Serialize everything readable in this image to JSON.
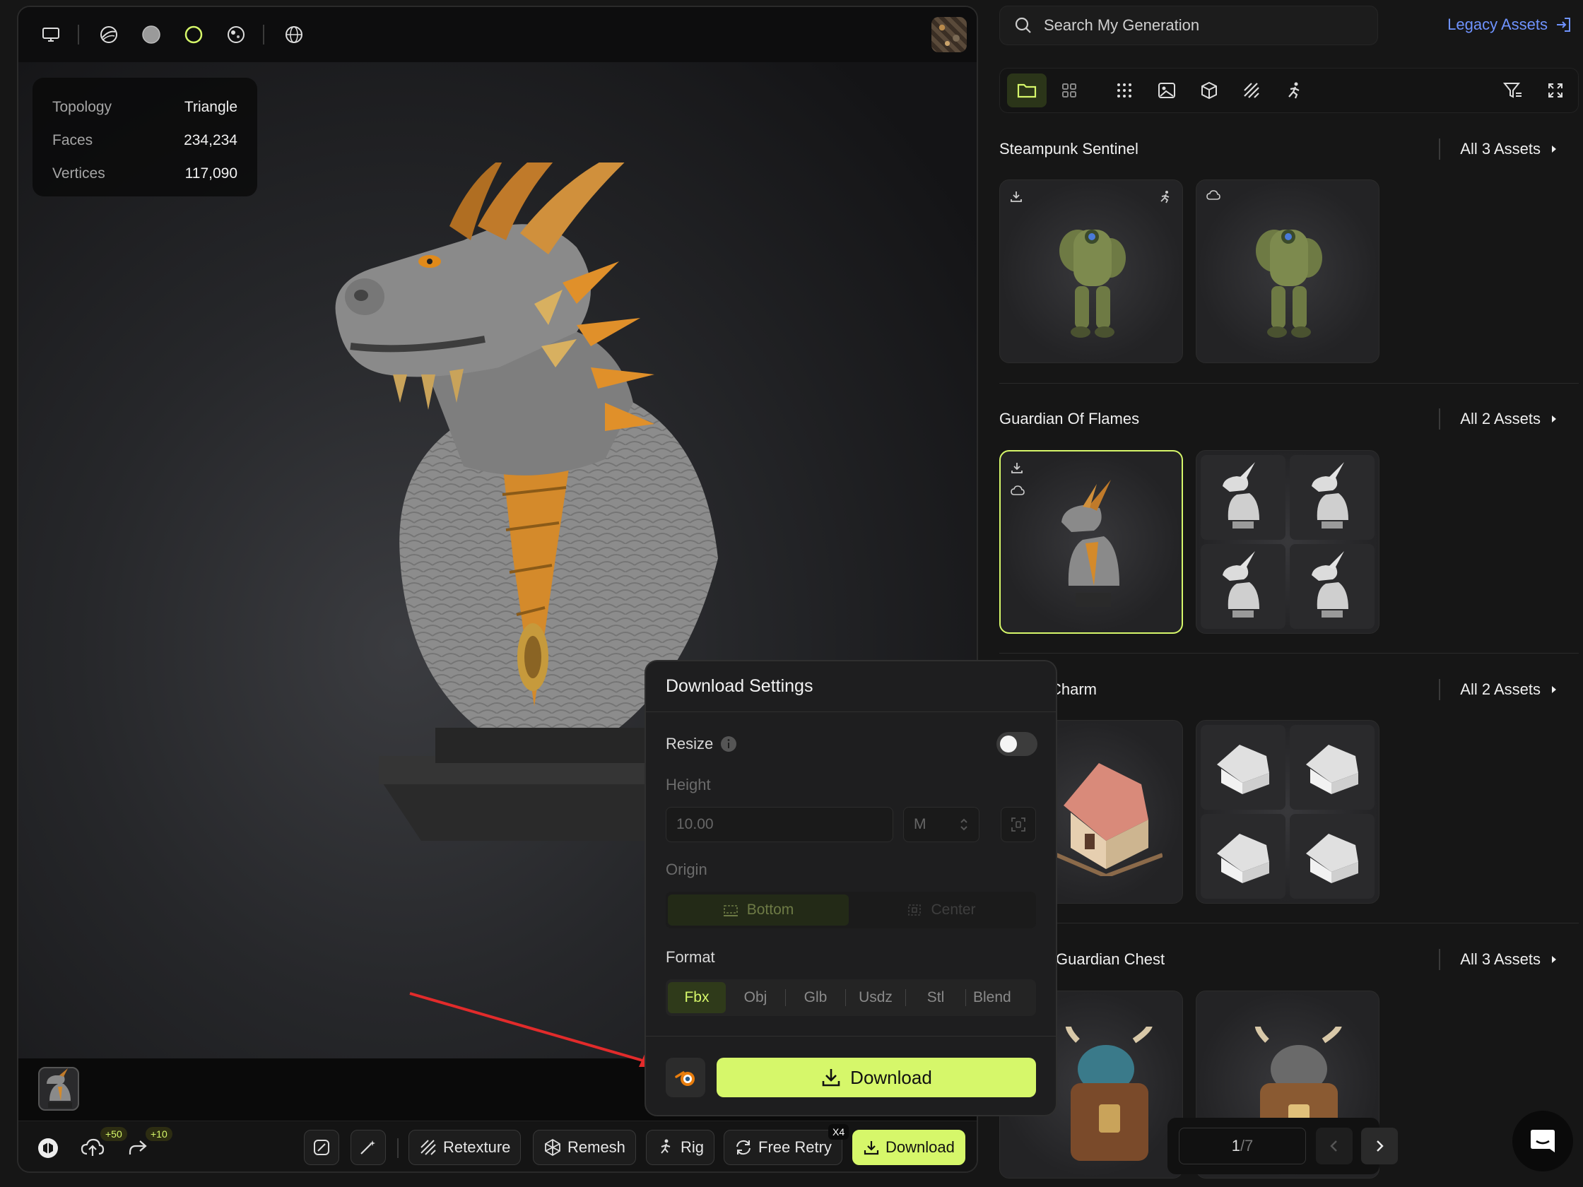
{
  "viewer": {
    "stats": [
      {
        "label": "Topology",
        "value": "Triangle"
      },
      {
        "label": "Faces",
        "value": "234,234"
      },
      {
        "label": "Vertices",
        "value": "117,090"
      }
    ],
    "top_icons": [
      "monitor-icon",
      "wireframe-sphere-icon",
      "solid-sphere-icon",
      "outline-sphere-icon",
      "textured-sphere-icon",
      "globe-icon"
    ]
  },
  "toolbar": {
    "upload_badge": "+50",
    "share_badge": "+10",
    "retexture": "Retexture",
    "remesh": "Remesh",
    "rig": "Rig",
    "free_retry": "Free Retry",
    "free_retry_badge": "X4",
    "download": "Download"
  },
  "download_dialog": {
    "title": "Download Settings",
    "resize_label": "Resize",
    "resize_enabled": false,
    "height_label": "Height",
    "height_value": "10.00",
    "unit_value": "M",
    "origin_label": "Origin",
    "origin_options": [
      "Bottom",
      "Center"
    ],
    "origin_selected": "Bottom",
    "format_label": "Format",
    "formats": [
      "Fbx",
      "Obj",
      "Glb",
      "Usdz",
      "Stl",
      "Blend"
    ],
    "format_selected": "Fbx",
    "download_label": "Download"
  },
  "right_panel": {
    "search_placeholder": "Search My Generation",
    "legacy_label": "Legacy Assets",
    "sections": [
      {
        "title": "Steampunk Sentinel",
        "all": "All 3 Assets"
      },
      {
        "title": "Guardian Of Flames",
        "all": "All 2 Assets"
      },
      {
        "title": "Charm",
        "all": "All 2 Assets"
      },
      {
        "title": "Guardian Chest",
        "all": "All 3 Assets"
      }
    ],
    "pager": {
      "current": "1",
      "total": "/7"
    }
  },
  "colors": {
    "accent": "#d6f76a",
    "link": "#6f93ff",
    "background": "#161616"
  }
}
